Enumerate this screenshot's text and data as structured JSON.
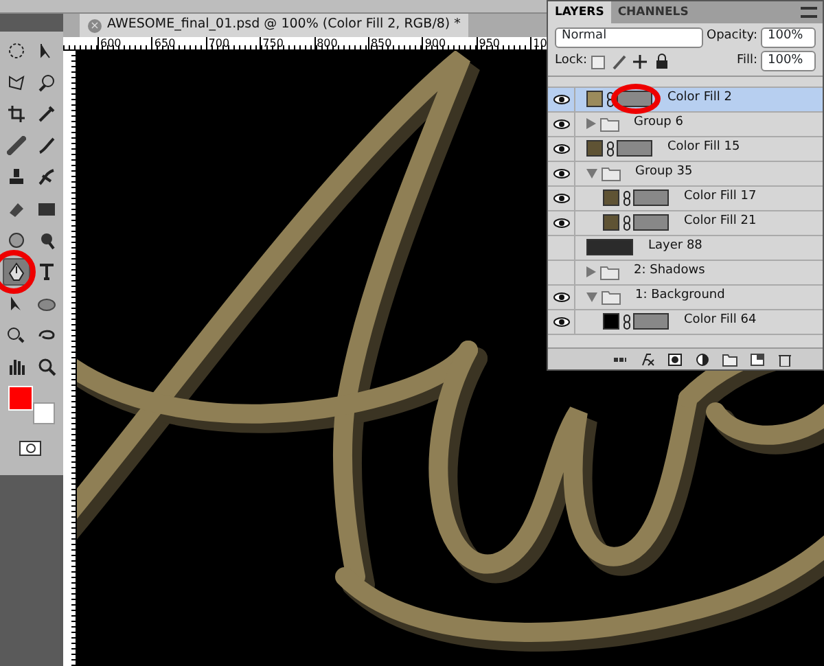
{
  "document": {
    "title": "AWESOME_final_01.psd @ 100% (Color Fill 2, RGB/8) *",
    "close": "×",
    "ruler_labels": [
      "600",
      "650",
      "700",
      "750",
      "800",
      "850",
      "900",
      "950",
      "10"
    ]
  },
  "tools": [
    {
      "selected": false
    },
    {
      "selected": false
    },
    {
      "selected": false
    },
    {
      "selected": false
    },
    {
      "selected": false
    },
    {
      "selected": false
    },
    {
      "selected": false
    },
    {
      "selected": false
    },
    {
      "selected": false
    },
    {
      "selected": false
    },
    {
      "selected": false
    },
    {
      "selected": false
    },
    {
      "selected": false
    },
    {
      "selected": false
    },
    {
      "selected": true
    },
    {
      "selected": false
    },
    {
      "selected": false
    },
    {
      "selected": false
    },
    {
      "selected": false
    },
    {
      "selected": false
    },
    {
      "selected": false
    },
    {
      "selected": false
    }
  ],
  "layers_panel": {
    "tabs": [
      {
        "label": "LAYERS",
        "selected": true
      },
      {
        "label": "CHANNELS",
        "selected": false
      }
    ],
    "blend_mode": "Normal",
    "opacity_label": "Opacity:",
    "opacity": "100%",
    "lock_label": "Lock:",
    "fill_label": "Fill:",
    "fill": "100%",
    "layers": [
      {
        "name": "Color Fill 2",
        "kind": "fill",
        "visible": true,
        "selected": true,
        "color": "#9b8b5c"
      },
      {
        "name": "Group 6",
        "kind": "group",
        "visible": true,
        "selected": false,
        "expanded": false
      },
      {
        "name": "Color Fill 15",
        "kind": "fill",
        "visible": true,
        "selected": false,
        "color": "#5f5334"
      },
      {
        "name": "Group 35",
        "kind": "group",
        "visible": true,
        "selected": false,
        "expanded": true,
        "children": [
          {
            "name": "Color Fill 17",
            "kind": "fill",
            "visible": true,
            "selected": false,
            "color": "#5f5334"
          },
          {
            "name": "Color Fill 21",
            "kind": "fill",
            "visible": true,
            "selected": false,
            "color": "#5f5334"
          }
        ]
      },
      {
        "name": "Layer 88",
        "kind": "pixel",
        "visible": false,
        "selected": false
      },
      {
        "name": "2: Shadows",
        "kind": "group",
        "visible": false,
        "selected": false,
        "expanded": false
      },
      {
        "name": "1: Background",
        "kind": "group",
        "visible": true,
        "selected": false,
        "expanded": true,
        "children": [
          {
            "name": "Color Fill 64",
            "kind": "fill",
            "visible": true,
            "selected": false,
            "color": "#000000"
          }
        ]
      }
    ]
  }
}
